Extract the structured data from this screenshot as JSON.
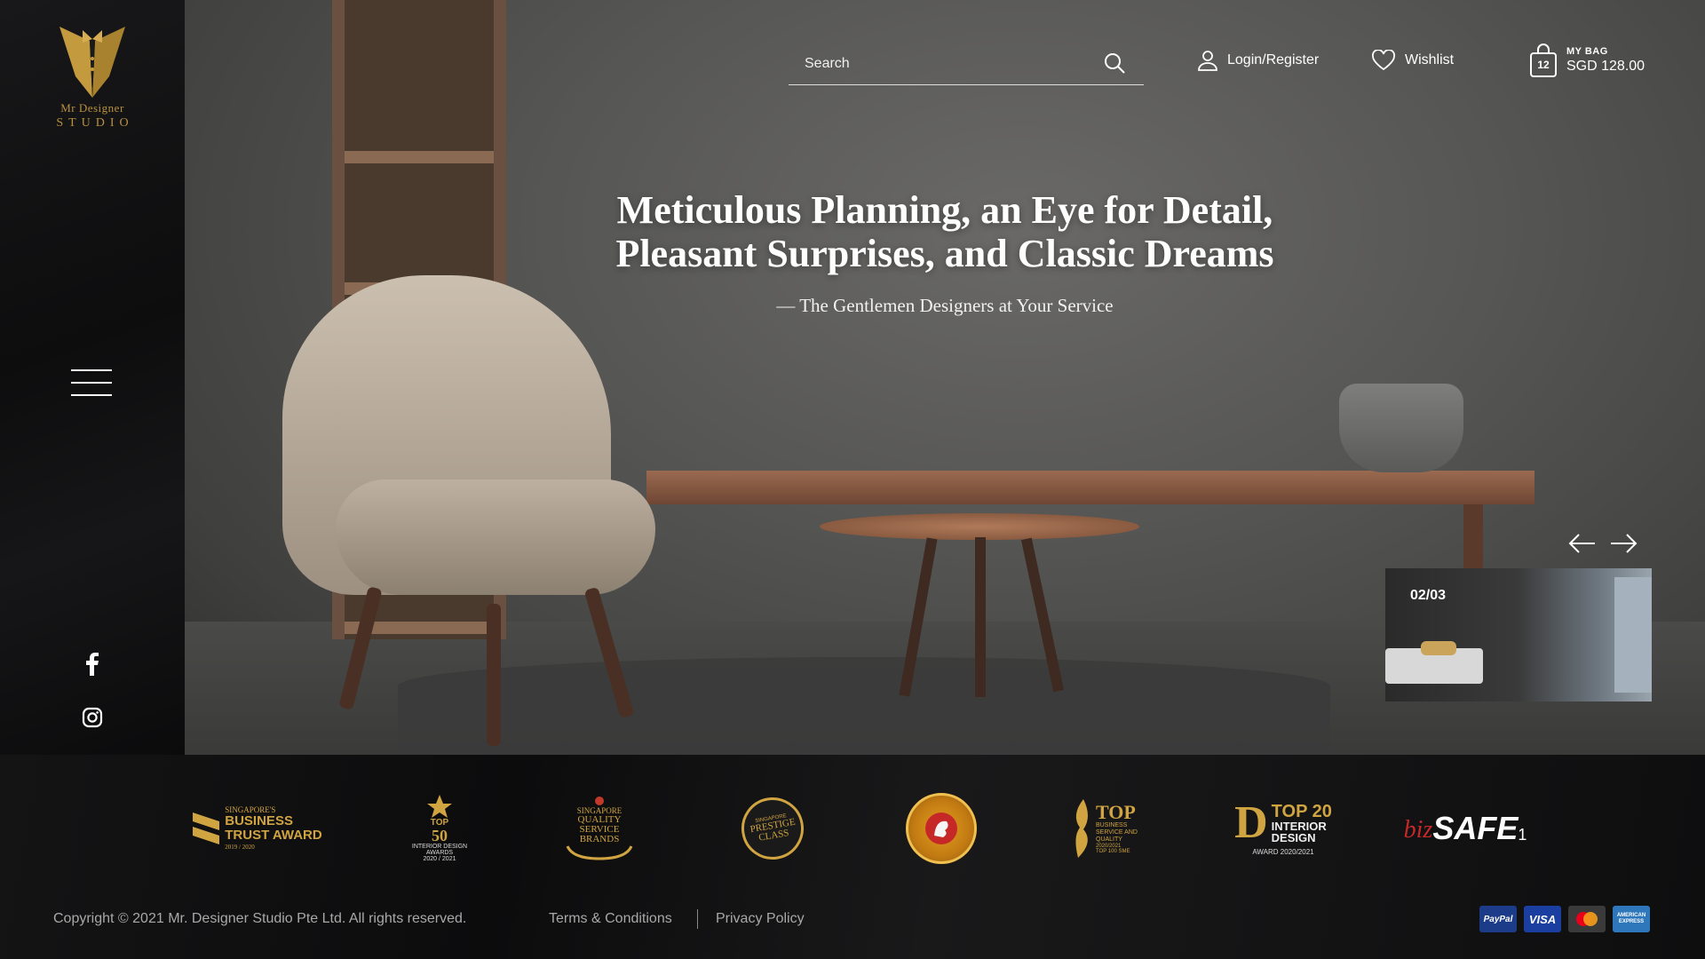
{
  "brand": {
    "line1": "Mr Designer",
    "line2": "STUDIO"
  },
  "header": {
    "search_placeholder": "Search",
    "login_label": "Login/Register",
    "wishlist_label": "Wishlist",
    "bag_label": "MY BAG",
    "bag_count": "12",
    "bag_total": "SGD 128.00"
  },
  "hero": {
    "headline_line1": "Meticulous Planning, an Eye for Detail,",
    "headline_line2": "Pleasant Surprises, and Classic Dreams",
    "subheadline": "— The Gentlemen Designers at Your Service",
    "slide_counter": "02/03"
  },
  "awards": {
    "a1_line1": "SINGAPORE'S",
    "a1_line2": "BUSINESS",
    "a1_line3": "TRUST AWARD",
    "a1_line4": "2019 / 2020",
    "a2_line1": "TOP",
    "a2_line2": "50",
    "a2_line3": "INTERIOR DESIGN AWARDS",
    "a2_line4": "2020 / 2021",
    "a3_line1": "SINGAPORE",
    "a3_line2": "QUALITY SERVICE BRANDS",
    "a4_line1": "SINGAPORE",
    "a4_line2": "PRESTIGE CLASS",
    "a6_line1": "TOP",
    "a6_line2": "BUSINESS SERVICE AND QUALITY",
    "a6_line3": "2020/2021",
    "a6_line4": "TOP 100 SME",
    "a7_line1": "TOP 20",
    "a7_line2": "INTERIOR",
    "a7_line3": "DESIGN",
    "a7_line4": "AWARD 2020/2021",
    "a8_biz": "biz",
    "a8_safe": "SAFE",
    "a8_num": "1"
  },
  "footer": {
    "copyright": "Copyright © 2021 Mr. Designer Studio Pte Ltd. All rights reserved.",
    "terms": "Terms & Conditions",
    "privacy": "Privacy Policy",
    "payments": [
      "PayPal",
      "VISA",
      "Mastercard",
      "AMERICAN EXPRESS"
    ]
  },
  "icons": {
    "menu": "hamburger-menu-icon",
    "facebook": "facebook-icon",
    "instagram": "instagram-icon",
    "search": "search-icon",
    "user": "user-icon",
    "heart": "heart-icon",
    "bag": "shopping-bag-icon",
    "prev": "arrow-left-icon",
    "next": "arrow-right-icon"
  },
  "colors": {
    "gold": "#d0a441",
    "background": "#0f0f10"
  }
}
